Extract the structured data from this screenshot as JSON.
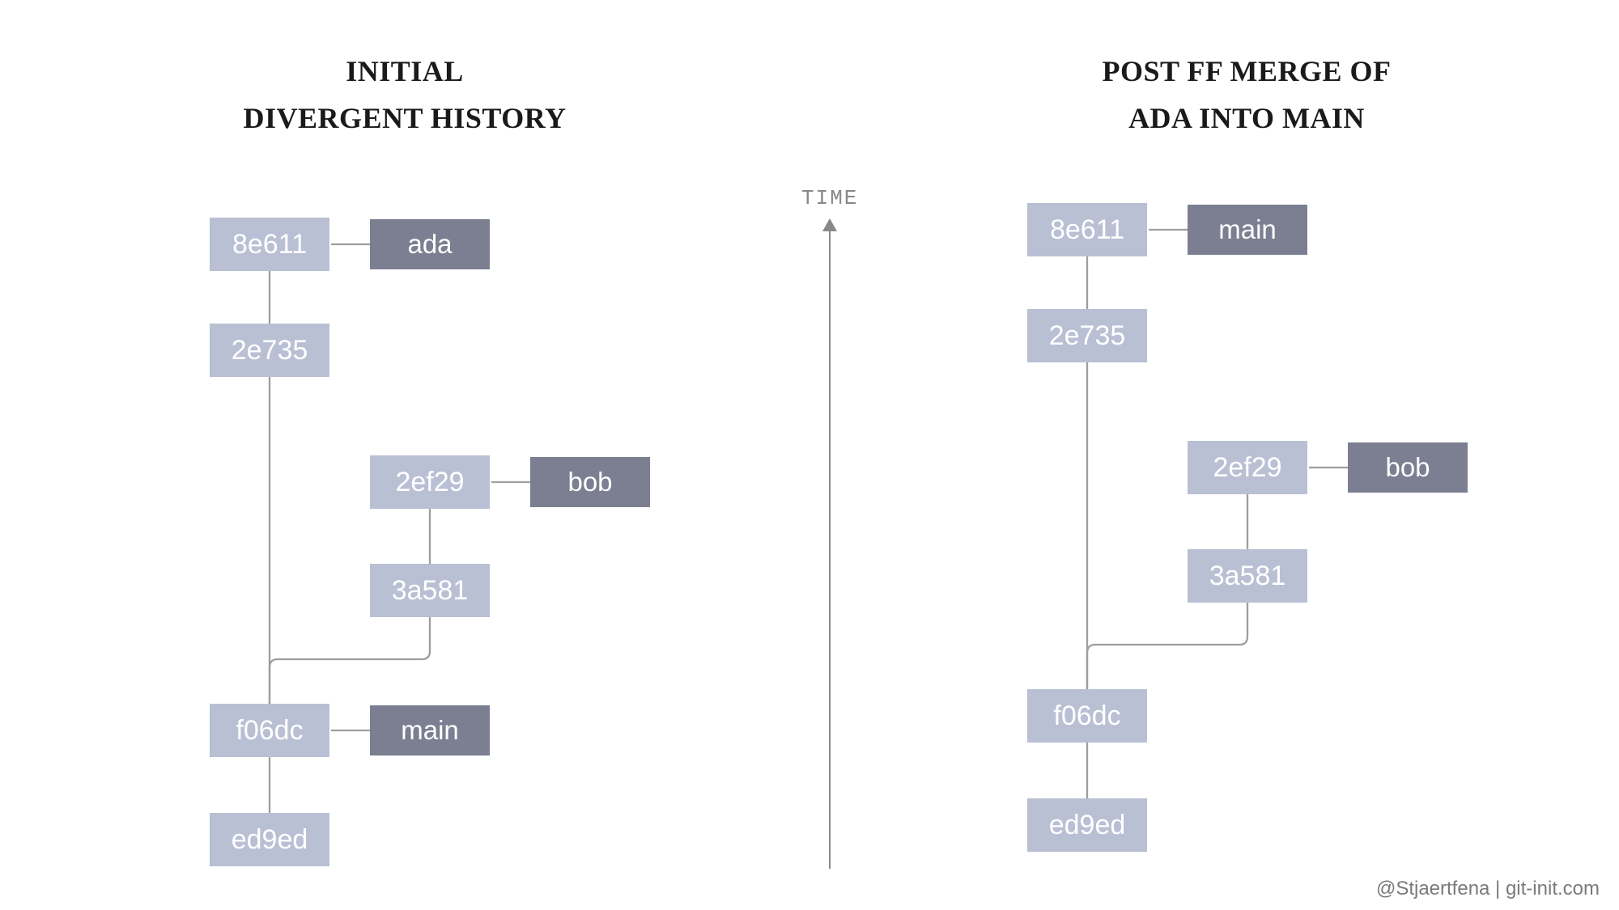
{
  "left": {
    "title_line1": "Initial",
    "title_line2": "Divergent History",
    "commits": {
      "c1": "8e611",
      "c2": "2e735",
      "c3": "2ef29",
      "c4": "3a581",
      "c5": "f06dc",
      "c6": "ed9ed"
    },
    "branches": {
      "ada": "ada",
      "bob": "bob",
      "main": "main"
    }
  },
  "right": {
    "title_line1": "Post FF merge of",
    "title_line2": "Ada into main",
    "commits": {
      "c1": "8e611",
      "c2": "2e735",
      "c3": "2ef29",
      "c4": "3a581",
      "c5": "f06dc",
      "c6": "ed9ed"
    },
    "branches": {
      "main": "main",
      "bob": "bob"
    }
  },
  "time_label": "TIME",
  "attribution": "@Stjaertfena | git-init.com"
}
